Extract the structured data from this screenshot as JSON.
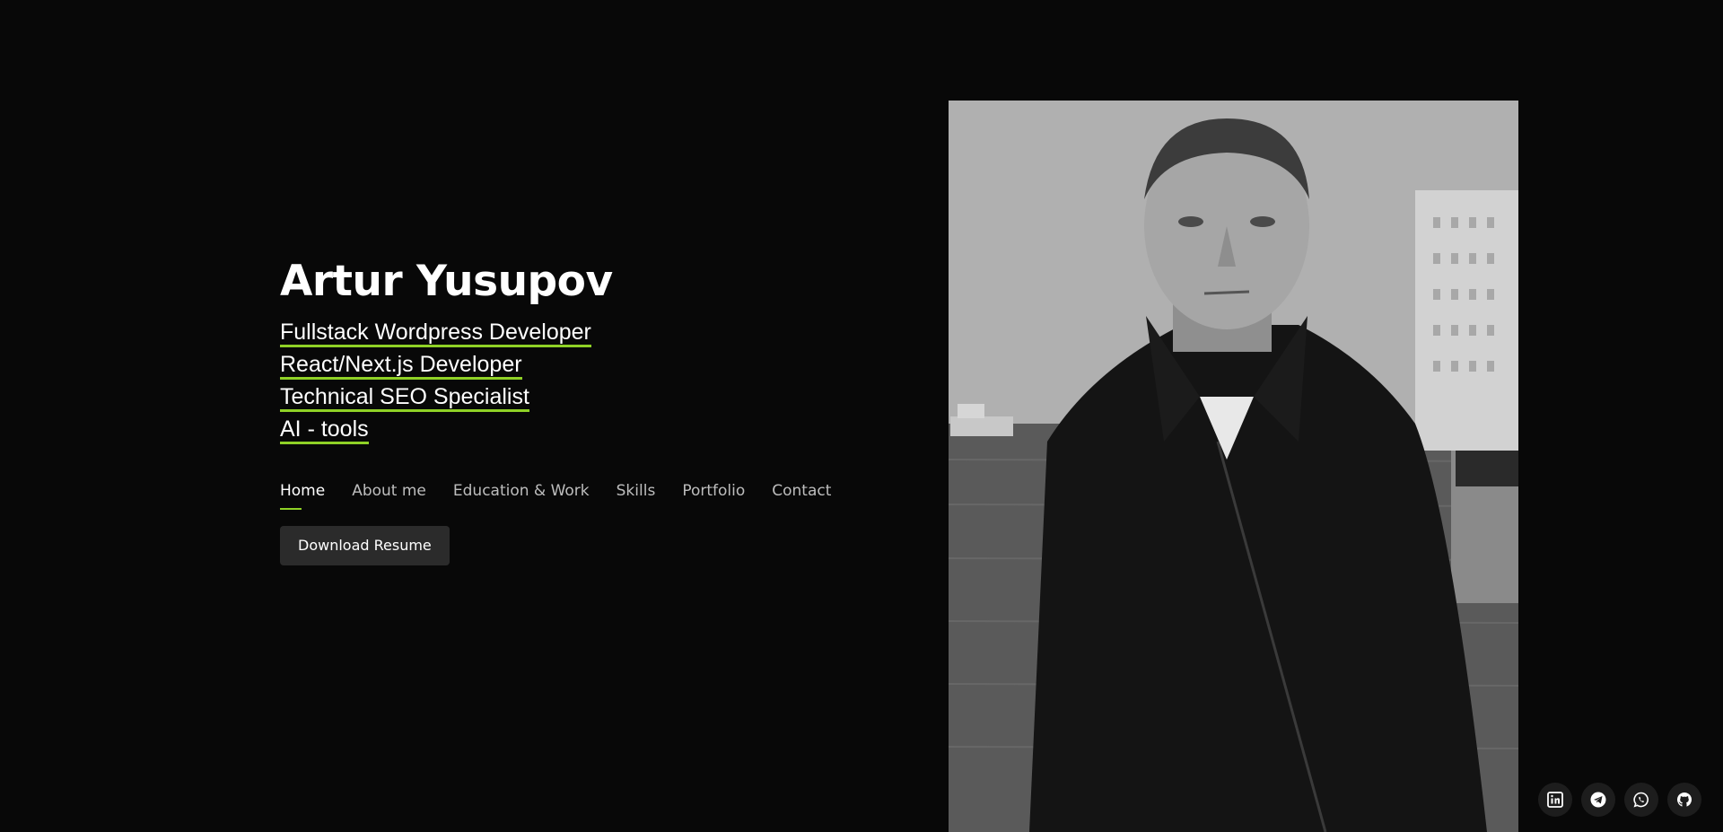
{
  "hero": {
    "name": "Artur Yusupov",
    "roles": [
      "Fullstack Wordpress Developer",
      "React/Next.js Developer",
      "Technical SEO Specialist",
      "AI - tools"
    ]
  },
  "nav": {
    "items": [
      "Home",
      "About me",
      "Education & Work",
      "Skills",
      "Portfolio",
      "Contact"
    ],
    "active": "Home"
  },
  "resume_button": {
    "label": "Download Resume"
  },
  "socials": {
    "icons": [
      "linkedin-icon",
      "telegram-icon",
      "whatsapp-icon",
      "github-icon"
    ]
  },
  "colors": {
    "background": "#080808",
    "accent": "#8fd126",
    "button_bg": "#2b2b2b"
  }
}
